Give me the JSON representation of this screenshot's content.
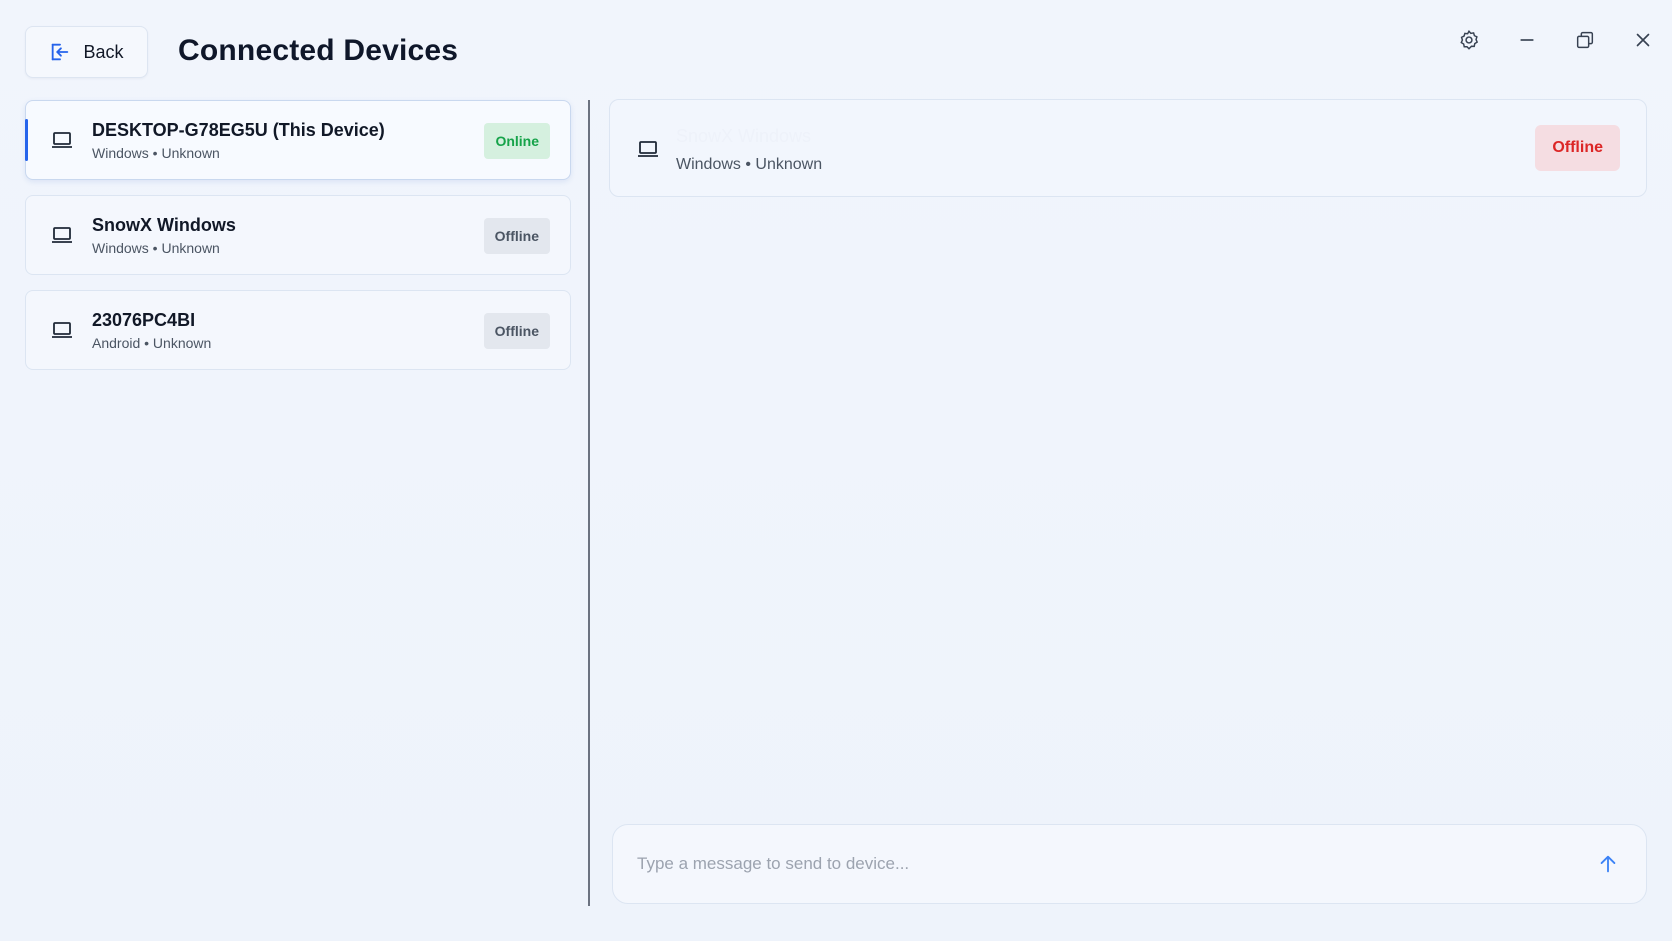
{
  "header": {
    "back_label": "Back",
    "title": "Connected Devices"
  },
  "window_controls": {
    "icons": [
      "settings-icon",
      "minimize-icon",
      "restore-icon",
      "close-icon"
    ]
  },
  "devices": [
    {
      "name": "DESKTOP-G78EG5U (This Device)",
      "meta": "Windows • Unknown",
      "status": "Online",
      "selected": true,
      "icon": "laptop-icon"
    },
    {
      "name": "SnowX Windows",
      "meta": "Windows • Unknown",
      "status": "Offline",
      "selected": false,
      "icon": "laptop-icon"
    },
    {
      "name": "23076PC4BI",
      "meta": "Android • Unknown",
      "status": "Offline",
      "selected": false,
      "icon": "laptop-icon"
    }
  ],
  "detail": {
    "name": "SnowX Windows",
    "meta": "Windows • Unknown",
    "status": "Offline"
  },
  "message": {
    "placeholder": "Type a message to send to device...",
    "value": ""
  },
  "colors": {
    "accent": "#2563eb",
    "online": "#16a34a",
    "offline_alert": "#dc2626",
    "background": "#eef3fb"
  }
}
